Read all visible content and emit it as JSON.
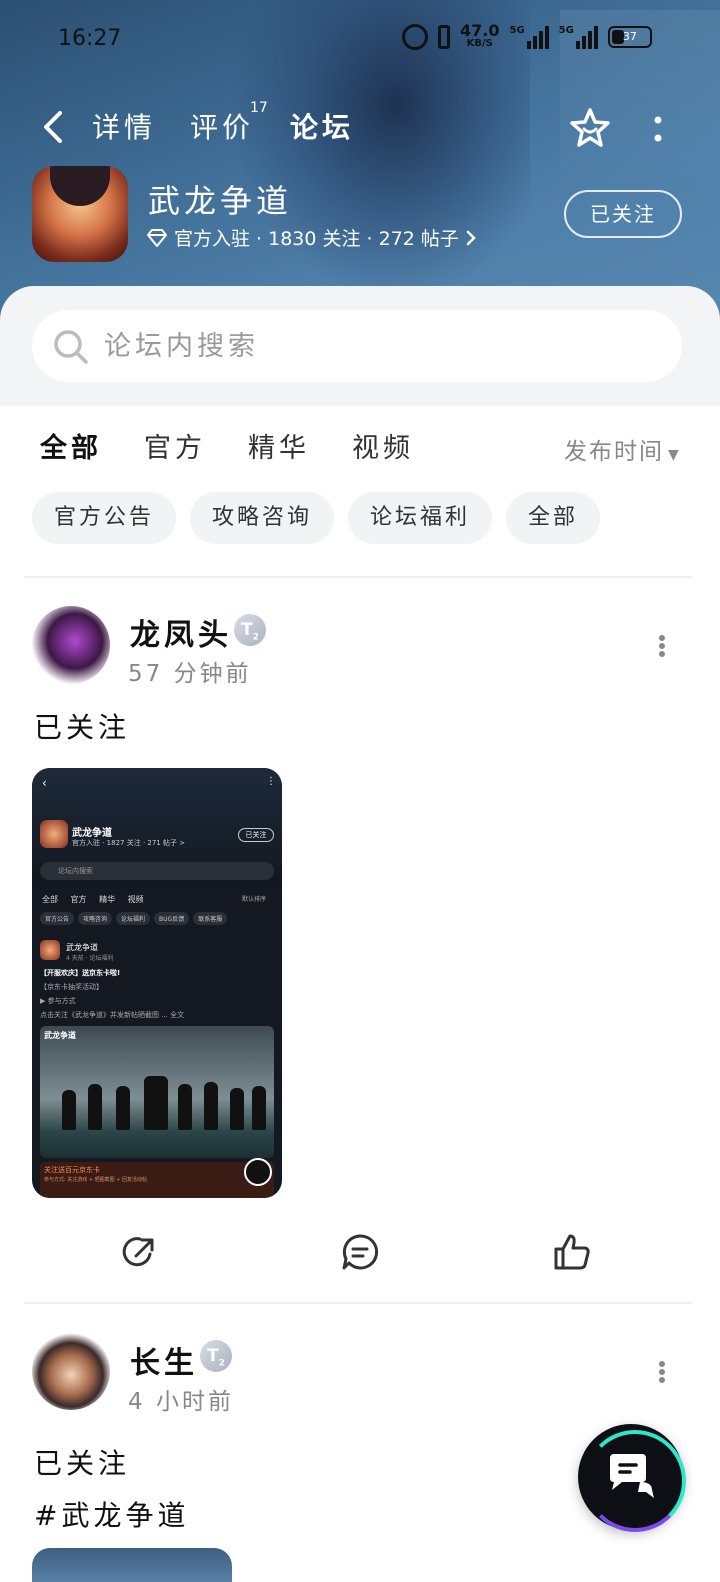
{
  "status_bar": {
    "time": "16:27",
    "net_speed": "47.0",
    "net_unit": "KB/S",
    "sig1": "5G",
    "sig2": "5G",
    "battery": "37"
  },
  "nav": {
    "tabs": [
      {
        "label": "详情"
      },
      {
        "label": "评价",
        "count": "17"
      },
      {
        "label": "论坛"
      }
    ],
    "active_tab": "论坛"
  },
  "game": {
    "name": "武龙争道",
    "meta": "官方入驻 · 1830 关注 · 272 帖子",
    "follow_label": "已关注"
  },
  "search": {
    "placeholder": "论坛内搜索"
  },
  "filter": {
    "tabs": [
      "全部",
      "官方",
      "精华",
      "视频"
    ],
    "active": "全部",
    "sort_label": "发布时间",
    "chips": [
      "官方公告",
      "攻略咨询",
      "论坛福利",
      "全部"
    ]
  },
  "posts": [
    {
      "user": "龙凤头",
      "badge": "T",
      "badge_level": "2",
      "time": "57 分钟前",
      "text": "已关注",
      "screenshot": {
        "game_name": "武龙争道",
        "meta": "官方入驻 · 1827 关注 · 271 帖子 >",
        "follow": "已关注",
        "search": "论坛内搜索",
        "tabs": [
          "全部",
          "官方",
          "精华",
          "视频"
        ],
        "sort": "默认排序",
        "chips": [
          "官方公告",
          "攻略咨询",
          "论坛福利",
          "BUG反馈",
          "联系客服"
        ],
        "post_user": "武龙争道",
        "post_time": "4 天前 · 论坛福利",
        "line1": "【开服欢庆】送京东卡啦!",
        "line2": "【京东卡抽奖活动】",
        "line3": "▶ 参与方式",
        "line4": "点击关注《武龙争道》并发新帖晒截图 ... 全文",
        "img_logo": "武龙争道",
        "bottom_title": "关注送百元京东卡",
        "bottom_sub": "参与方式: 关注游戏 + 晒图截图 + 回复活动帖"
      }
    },
    {
      "user": "长生",
      "badge": "T",
      "badge_level": "2",
      "time": "4 小时前",
      "text": "已关注",
      "tag": "#武龙争道"
    }
  ],
  "icons": {
    "back": "back-arrow-icon",
    "favorite": "star-smile-icon",
    "more": "more-vertical-icon",
    "search": "search-icon",
    "share": "share-icon",
    "comment": "comment-icon",
    "like": "thumbs-up-icon",
    "chat_fab": "chat-bubble-icon"
  },
  "colors": {
    "accent": "#1de0c0",
    "header_bg": "#4f80aa",
    "fab_ring_teal": "#2ee6c8",
    "fab_ring_purple": "#7a4cf0"
  }
}
